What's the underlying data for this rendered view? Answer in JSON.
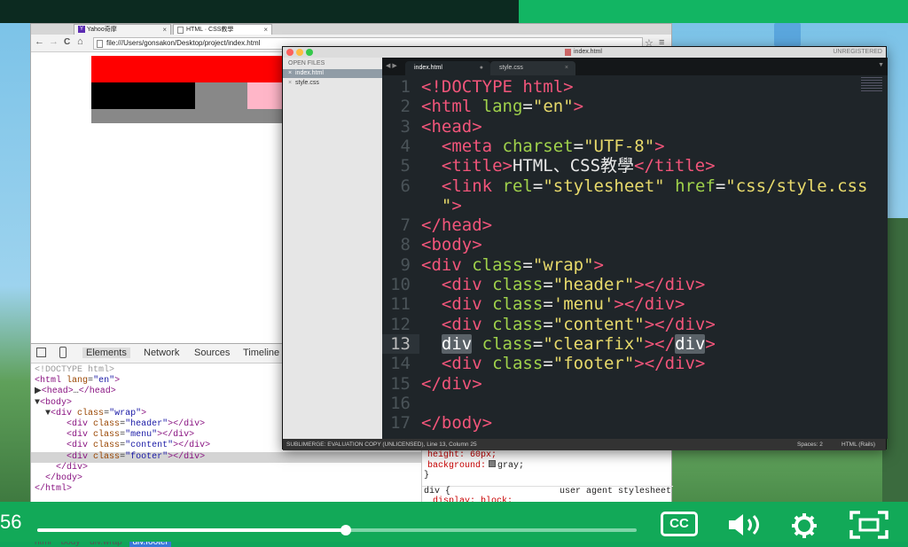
{
  "chrome": {
    "tabs": [
      {
        "label": "Yahoo奇摩",
        "close": "×"
      },
      {
        "label": "HTML · CSS教學",
        "close": "×"
      }
    ],
    "nav": {
      "back": "←",
      "forward": "→",
      "reload": "C",
      "home": "⌂"
    },
    "url": "file:///Users/gonsakon/Desktop/project/index.html",
    "star": "☆",
    "menu": "≡"
  },
  "colors": {
    "header": "#ff0000",
    "menu": "#000000",
    "content": "#888888",
    "pink": "#ffb6c8",
    "footer": "#888888"
  },
  "devtools": {
    "tabs": [
      "Elements",
      "Network",
      "Sources",
      "Timeline"
    ],
    "styles": {
      "rule1_prop": "height: 60px;",
      "rule1_bg_prop": "background:",
      "rule1_bg_val": "gray;",
      "rule1_close": "}",
      "rule2_selector": "div {",
      "rule2_source": "user agent stylesheet",
      "rule2_prop": "display: block;",
      "rule2_close": "}"
    },
    "breadcrumbs": [
      "html",
      "body",
      "div.wrap",
      "div.footer"
    ]
  },
  "sublime": {
    "window_title": "index.html",
    "unregistered": "UNREGISTERED",
    "sidebar_header": "OPEN FILES",
    "open_files": [
      "index.html",
      "style.css"
    ],
    "tabs": [
      "index.html",
      "style.css"
    ],
    "status_left": "SUBLIMERGE: EVALUATION COPY (UNLICENSED), Line 13, Column 25",
    "spaces": "Spaces: 2",
    "syntax": "HTML (Rails)"
  },
  "player": {
    "time": "56",
    "progress": 0.515,
    "cc_label": "CC"
  }
}
